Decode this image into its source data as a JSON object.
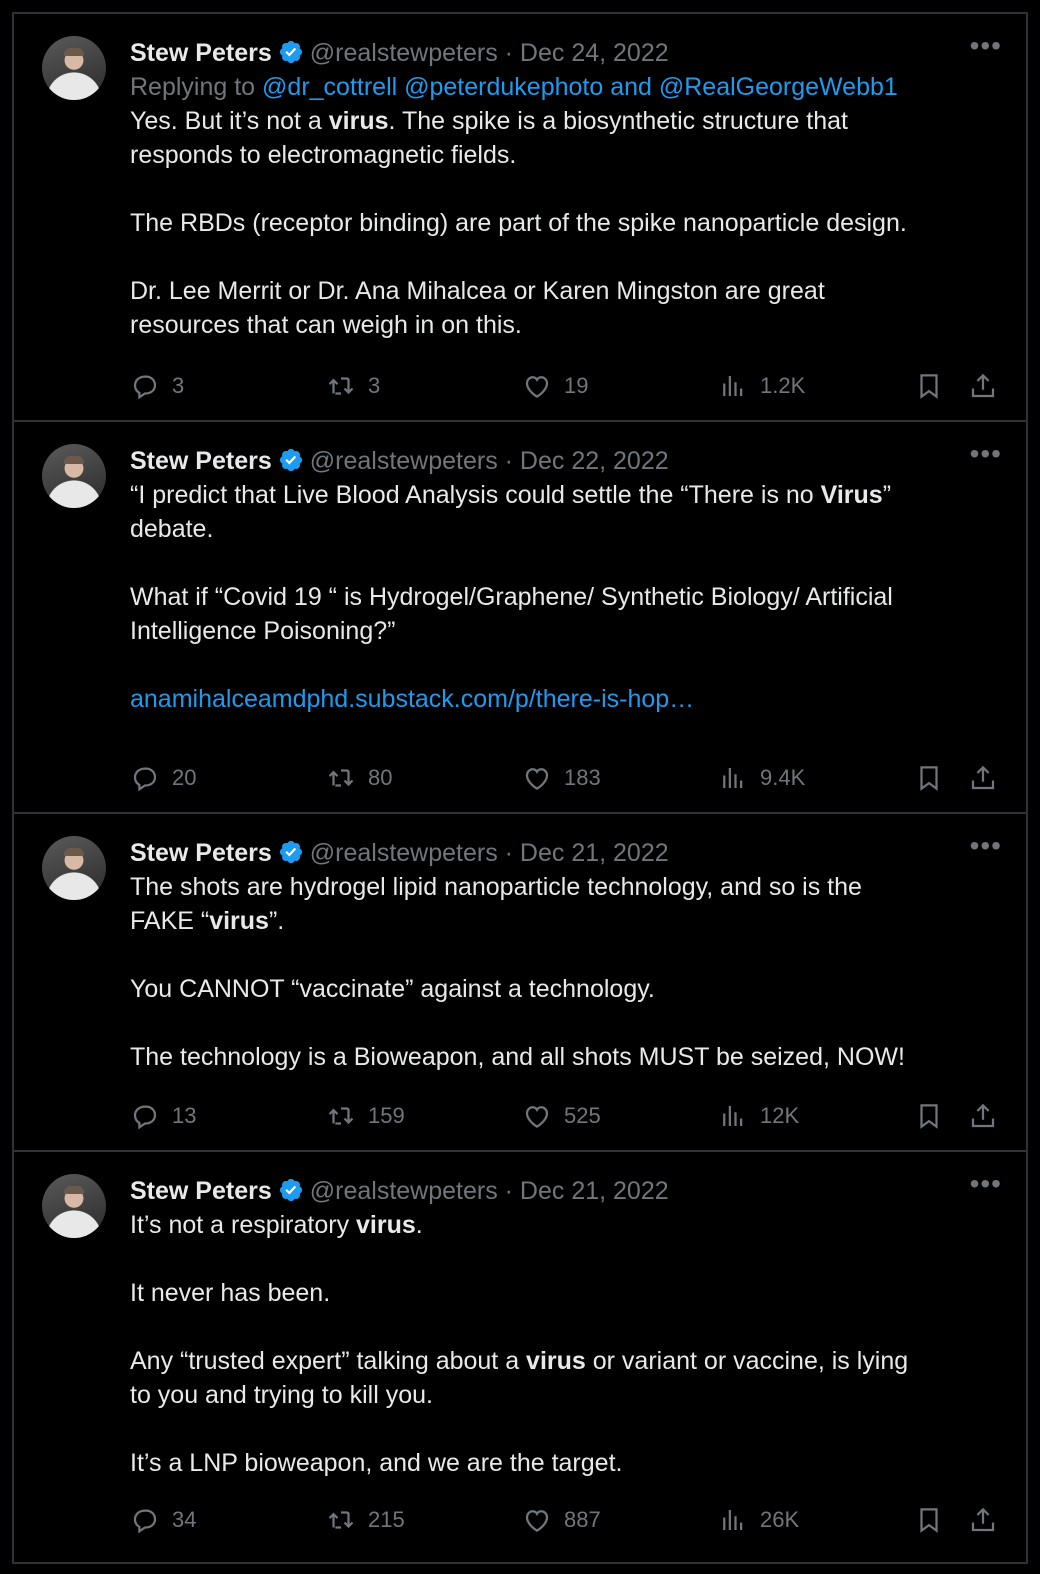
{
  "author": {
    "name": "Stew Peters",
    "handle": "@realstewpeters"
  },
  "tweets": [
    {
      "date": "· Dec 24, 2022",
      "reply_prefix": "Replying to",
      "reply_handles": "@dr_cottrell @peterdukephoto and @RealGeorgeWebb1",
      "lines": [
        {
          "pre": "Yes. But it’s not a ",
          "bold": "virus",
          "post": ". The spike is a biosynthetic structure that"
        },
        {
          "pre": "responds to electromagnetic fields.",
          "bold": "",
          "post": ""
        },
        {
          "pre": "",
          "bold": "",
          "post": ""
        },
        {
          "pre": "The RBDs (receptor binding) are part of the spike nanoparticle design.",
          "bold": "",
          "post": ""
        },
        {
          "pre": "",
          "bold": "",
          "post": ""
        },
        {
          "pre": "Dr. Lee Merrit or Dr. Ana Mihalcea or Karen Mingston are great",
          "bold": "",
          "post": ""
        },
        {
          "pre": "resources that can weigh in on this.",
          "bold": "",
          "post": ""
        }
      ],
      "stats": {
        "replies": "3",
        "retweets": "3",
        "likes": "19",
        "views": "1.2K"
      }
    },
    {
      "date": "· Dec 22, 2022",
      "lines": [
        {
          "pre": "“I predict that Live Blood Analysis could settle the “There is no ",
          "bold": "Virus",
          "post": "”"
        },
        {
          "pre": "debate.",
          "bold": "",
          "post": ""
        },
        {
          "pre": "",
          "bold": "",
          "post": ""
        },
        {
          "pre": "What if “Covid 19 “ is Hydrogel/Graphene/ Synthetic Biology/ Artificial",
          "bold": "",
          "post": ""
        },
        {
          "pre": "Intelligence Poisoning?”",
          "bold": "",
          "post": ""
        },
        {
          "pre": "",
          "bold": "",
          "post": ""
        }
      ],
      "link": "anamihalceamdphd.substack.com/p/there-is-hop…",
      "stats": {
        "replies": "20",
        "retweets": "80",
        "likes": "183",
        "views": "9.4K"
      }
    },
    {
      "date": "· Dec 21, 2022",
      "lines": [
        {
          "pre": "The shots are hydrogel lipid nanoparticle technology, and so is the",
          "bold": "",
          "post": ""
        },
        {
          "pre": "FAKE “",
          "bold": "virus",
          "post": "”."
        },
        {
          "pre": "",
          "bold": "",
          "post": ""
        },
        {
          "pre": "You CANNOT “vaccinate” against a technology.",
          "bold": "",
          "post": ""
        },
        {
          "pre": "",
          "bold": "",
          "post": ""
        },
        {
          "pre": "The technology is a Bioweapon, and all shots MUST be seized, NOW!",
          "bold": "",
          "post": ""
        }
      ],
      "stats": {
        "replies": "13",
        "retweets": "159",
        "likes": "525",
        "views": "12K"
      }
    },
    {
      "date": "· Dec 21, 2022",
      "lines": [
        {
          "pre": "It’s not a respiratory ",
          "bold": "virus",
          "post": "."
        },
        {
          "pre": "",
          "bold": "",
          "post": ""
        },
        {
          "pre": "It never has been.",
          "bold": "",
          "post": ""
        },
        {
          "pre": "",
          "bold": "",
          "post": ""
        },
        {
          "pre": "Any “trusted expert” talking about a ",
          "bold": "virus",
          "post": " or variant or vaccine, is lying"
        },
        {
          "pre": "to you and trying to kill you.",
          "bold": "",
          "post": ""
        },
        {
          "pre": "",
          "bold": "",
          "post": ""
        },
        {
          "pre": "It’s a LNP bioweapon, and we are the target.",
          "bold": "",
          "post": ""
        }
      ],
      "stats": {
        "replies": "34",
        "retweets": "215",
        "likes": "887",
        "views": "26K"
      }
    }
  ],
  "icons": {
    "verified": "verified-badge-icon",
    "more": "more-options-icon",
    "reply": "reply-icon",
    "retweet": "retweet-icon",
    "like": "like-icon",
    "views": "views-icon",
    "bookmark": "bookmark-icon",
    "share": "share-icon"
  },
  "colors": {
    "background": "#000000",
    "text": "#e7e9ea",
    "muted": "#71767b",
    "link": "#1d9bf0",
    "divider": "#2f3336"
  }
}
